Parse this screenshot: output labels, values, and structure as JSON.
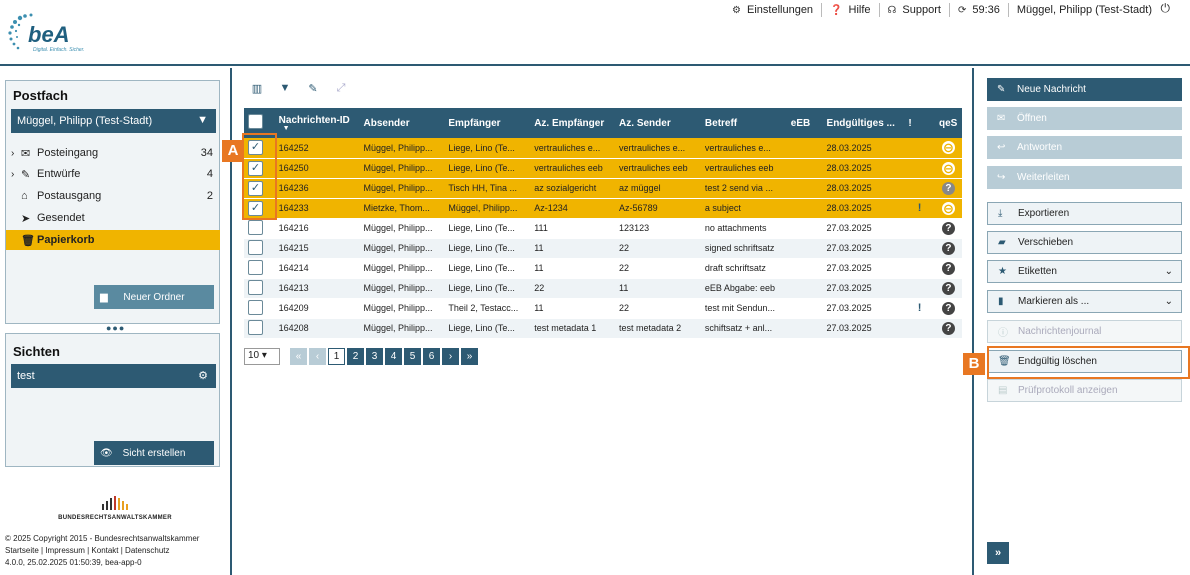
{
  "app": {
    "logo_text": "beA",
    "logo_tagline": "Digital. Einfach. Sicher."
  },
  "top_menu": {
    "settings": "Einstellungen",
    "help": "Hilfe",
    "support": "Support",
    "timer": "59:36",
    "user": "Müggel, Philipp (Test-Stadt)"
  },
  "postfach": {
    "title": "Postfach",
    "selected_mailbox": "Müggel, Philipp (Test-Stadt)",
    "folders": [
      {
        "label": "Posteingang",
        "count": "34",
        "expandable": true,
        "icon": "envelope-icon"
      },
      {
        "label": "Entwürfe",
        "count": "4",
        "expandable": true,
        "icon": "edit-icon"
      },
      {
        "label": "Postausgang",
        "count": "2",
        "expandable": false,
        "icon": "outbox-icon"
      },
      {
        "label": "Gesendet",
        "count": "",
        "expandable": false,
        "icon": "send-icon"
      },
      {
        "label": "Papierkorb",
        "count": "",
        "expandable": false,
        "icon": "trash-icon"
      }
    ],
    "new_folder_button": "Neuer Ordner"
  },
  "sichten": {
    "title": "Sichten",
    "selected": "test",
    "create_button": "Sicht erstellen"
  },
  "brak": {
    "name": "BUNDESRECHTSANWALTSKAMMER"
  },
  "footer": {
    "copyright": "© 2025 Copyright 2015 - Bundesrechtsanwaltskammer",
    "links": "Startseite | Impressum | Kontakt | Datenschutz",
    "version": "4.0.0, 25.02.2025 01:50:39, bea-app-0"
  },
  "grid": {
    "columns": [
      "Nachrichten-ID",
      "Absender",
      "Empfänger",
      "Az. Empfänger",
      "Az. Sender",
      "Betreff",
      "eEB",
      "Endgültiges ...",
      "!",
      "qeS"
    ],
    "rows": [
      {
        "id": "164252",
        "absender": "Müggel, Philipp...",
        "empfaenger": "Liege, Lino (Te...",
        "az_empf": "vertrauliches e...",
        "az_send": "vertrauliches e...",
        "betreff": "vertrauliches e...",
        "eeb": "",
        "datum": "28.03.2025",
        "excl": "",
        "qes": "minus",
        "selected": true
      },
      {
        "id": "164250",
        "absender": "Müggel, Philipp...",
        "empfaenger": "Liege, Lino (Te...",
        "az_empf": "vertrauliches eeb",
        "az_send": "vertrauliches eeb",
        "betreff": "vertrauliches eeb",
        "eeb": "",
        "datum": "28.03.2025",
        "excl": "",
        "qes": "minus",
        "selected": true
      },
      {
        "id": "164236",
        "absender": "Müggel, Philipp...",
        "empfaenger": "Tisch HH, Tina ...",
        "az_empf": "az sozialgericht",
        "az_send": "az müggel",
        "betreff": "test 2 send via ...",
        "eeb": "",
        "datum": "28.03.2025",
        "excl": "",
        "qes": "q-grey",
        "selected": true
      },
      {
        "id": "164233",
        "absender": "Mietzke, Thom...",
        "empfaenger": "Müggel, Philipp...",
        "az_empf": "Az-1234",
        "az_send": "Az-56789",
        "betreff": "a subject",
        "eeb": "",
        "datum": "28.03.2025",
        "excl": "!",
        "qes": "minus",
        "selected": true
      },
      {
        "id": "164216",
        "absender": "Müggel, Philipp...",
        "empfaenger": "Liege, Lino (Te...",
        "az_empf": "111",
        "az_send": "123123",
        "betreff": "no attachments",
        "eeb": "",
        "datum": "27.03.2025",
        "excl": "",
        "qes": "q-dark",
        "selected": false
      },
      {
        "id": "164215",
        "absender": "Müggel, Philipp...",
        "empfaenger": "Liege, Lino (Te...",
        "az_empf": "11",
        "az_send": "22",
        "betreff": "signed schriftsatz",
        "eeb": "",
        "datum": "27.03.2025",
        "excl": "",
        "qes": "q-dark",
        "selected": false
      },
      {
        "id": "164214",
        "absender": "Müggel, Philipp...",
        "empfaenger": "Liege, Lino (Te...",
        "az_empf": "11",
        "az_send": "22",
        "betreff": "draft schriftsatz",
        "eeb": "",
        "datum": "27.03.2025",
        "excl": "",
        "qes": "q-dark",
        "selected": false
      },
      {
        "id": "164213",
        "absender": "Müggel, Philipp...",
        "empfaenger": "Liege, Lino (Te...",
        "az_empf": "22",
        "az_send": "11",
        "betreff": "eEB Abgabe: eeb",
        "eeb": "",
        "datum": "27.03.2025",
        "excl": "",
        "qes": "q-dark",
        "selected": false
      },
      {
        "id": "164209",
        "absender": "Müggel, Philipp...",
        "empfaenger": "Theil 2, Testacc...",
        "az_empf": "11",
        "az_send": "22",
        "betreff": "test mit Sendun...",
        "eeb": "",
        "datum": "27.03.2025",
        "excl": "!",
        "qes": "q-dark",
        "selected": false
      },
      {
        "id": "164208",
        "absender": "Müggel, Philipp...",
        "empfaenger": "Liege, Lino (Te...",
        "az_empf": "test metadata 1",
        "az_send": "test metadata 2",
        "betreff": "schiftsatz + anl...",
        "eeb": "",
        "datum": "27.03.2025",
        "excl": "",
        "qes": "q-dark",
        "selected": false
      }
    ]
  },
  "pager": {
    "page_size": "10",
    "pages": [
      "1",
      "2",
      "3",
      "4",
      "5",
      "6"
    ],
    "current": "1"
  },
  "actions": {
    "new_message": "Neue Nachricht",
    "open": "Öffnen",
    "reply": "Antworten",
    "forward": "Weiterleiten",
    "export": "Exportieren",
    "move": "Verschieben",
    "labels": "Etiketten",
    "mark_as": "Markieren als ...",
    "journal": "Nachrichtenjournal",
    "delete_permanently": "Endgültig löschen",
    "audit_log": "Prüfprotokoll anzeigen"
  },
  "annotations": {
    "a": "A",
    "b": "B"
  },
  "colors": {
    "primary": "#2d5a73",
    "selected_row": "#f0b400",
    "highlight": "#e87722"
  }
}
